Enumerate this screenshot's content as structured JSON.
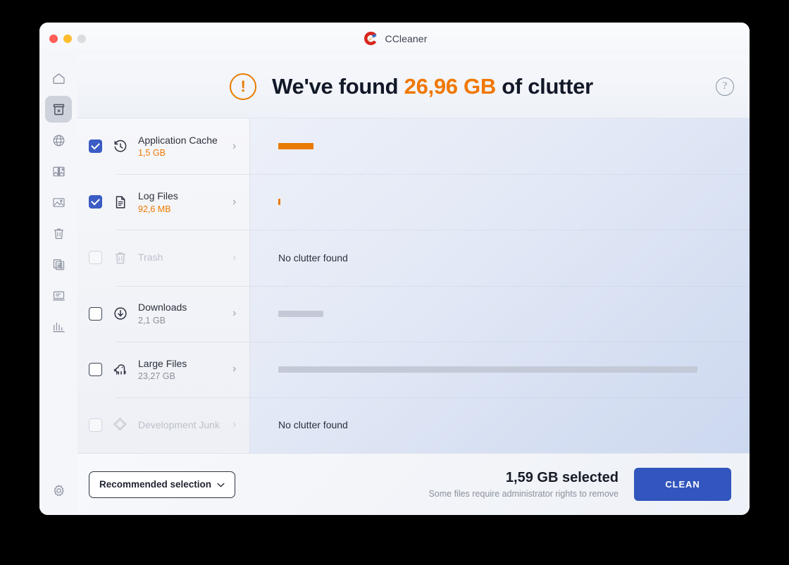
{
  "window": {
    "title": "CCleaner",
    "traffic_lights": [
      "close",
      "minimize",
      "zoom"
    ]
  },
  "header": {
    "alert_glyph": "!",
    "headline_prefix": "We've found ",
    "headline_amount": "26,96 GB",
    "headline_suffix": " of clutter",
    "help_glyph": "?",
    "accent_color": "#f07800"
  },
  "rail": {
    "items": [
      {
        "name": "home-icon",
        "active": false
      },
      {
        "name": "cleaner-icon",
        "active": true
      },
      {
        "name": "globe-icon",
        "active": false
      },
      {
        "name": "duplicate-finder-icon",
        "active": false
      },
      {
        "name": "photos-icon",
        "active": false
      },
      {
        "name": "trash-icon",
        "active": false
      },
      {
        "name": "app-manager-icon",
        "active": false
      },
      {
        "name": "system-icon",
        "active": false
      },
      {
        "name": "statistics-icon",
        "active": false
      }
    ],
    "settings": {
      "name": "gear-icon"
    }
  },
  "categories": [
    {
      "label": "Application Cache",
      "size": "1,5 GB",
      "checked": true,
      "enabled": true,
      "icon": "history-clock-icon",
      "bar_width_pct": 7.5,
      "bar_color": "#e97a05",
      "empty": false
    },
    {
      "label": "Log Files",
      "size": "92,6 MB",
      "checked": true,
      "enabled": true,
      "icon": "document-lines-icon",
      "bar_width_pct": 0.5,
      "bar_color": "#e97a05",
      "empty": false
    },
    {
      "label": "Trash",
      "size": "",
      "checked": false,
      "enabled": false,
      "icon": "trash-bin-icon",
      "bar_width_pct": 0,
      "bar_color": "",
      "empty": true,
      "empty_text": "No clutter found"
    },
    {
      "label": "Downloads",
      "size": "2,1 GB",
      "checked": false,
      "enabled": true,
      "icon": "download-circle-icon",
      "bar_width_pct": 9.5,
      "bar_color": "#c3c9d6",
      "empty": false
    },
    {
      "label": "Large Files",
      "size": "23,27 GB",
      "checked": false,
      "enabled": true,
      "icon": "elephant-icon",
      "bar_width_pct": 89,
      "bar_color": "#c3c9d6",
      "empty": false
    },
    {
      "label": "Development Junk",
      "size": "",
      "checked": false,
      "enabled": false,
      "icon": "puzzle-piece-icon",
      "bar_width_pct": 0,
      "bar_color": "",
      "empty": true,
      "empty_text": "No clutter found"
    }
  ],
  "footer": {
    "selection_label": "Recommended selection",
    "selection_caret": "⌄",
    "selected_size": "1,59 GB selected",
    "admin_note": "Some files require administrator rights to remove",
    "clean_label": "CLEAN",
    "clean_color": "#3256bd"
  }
}
